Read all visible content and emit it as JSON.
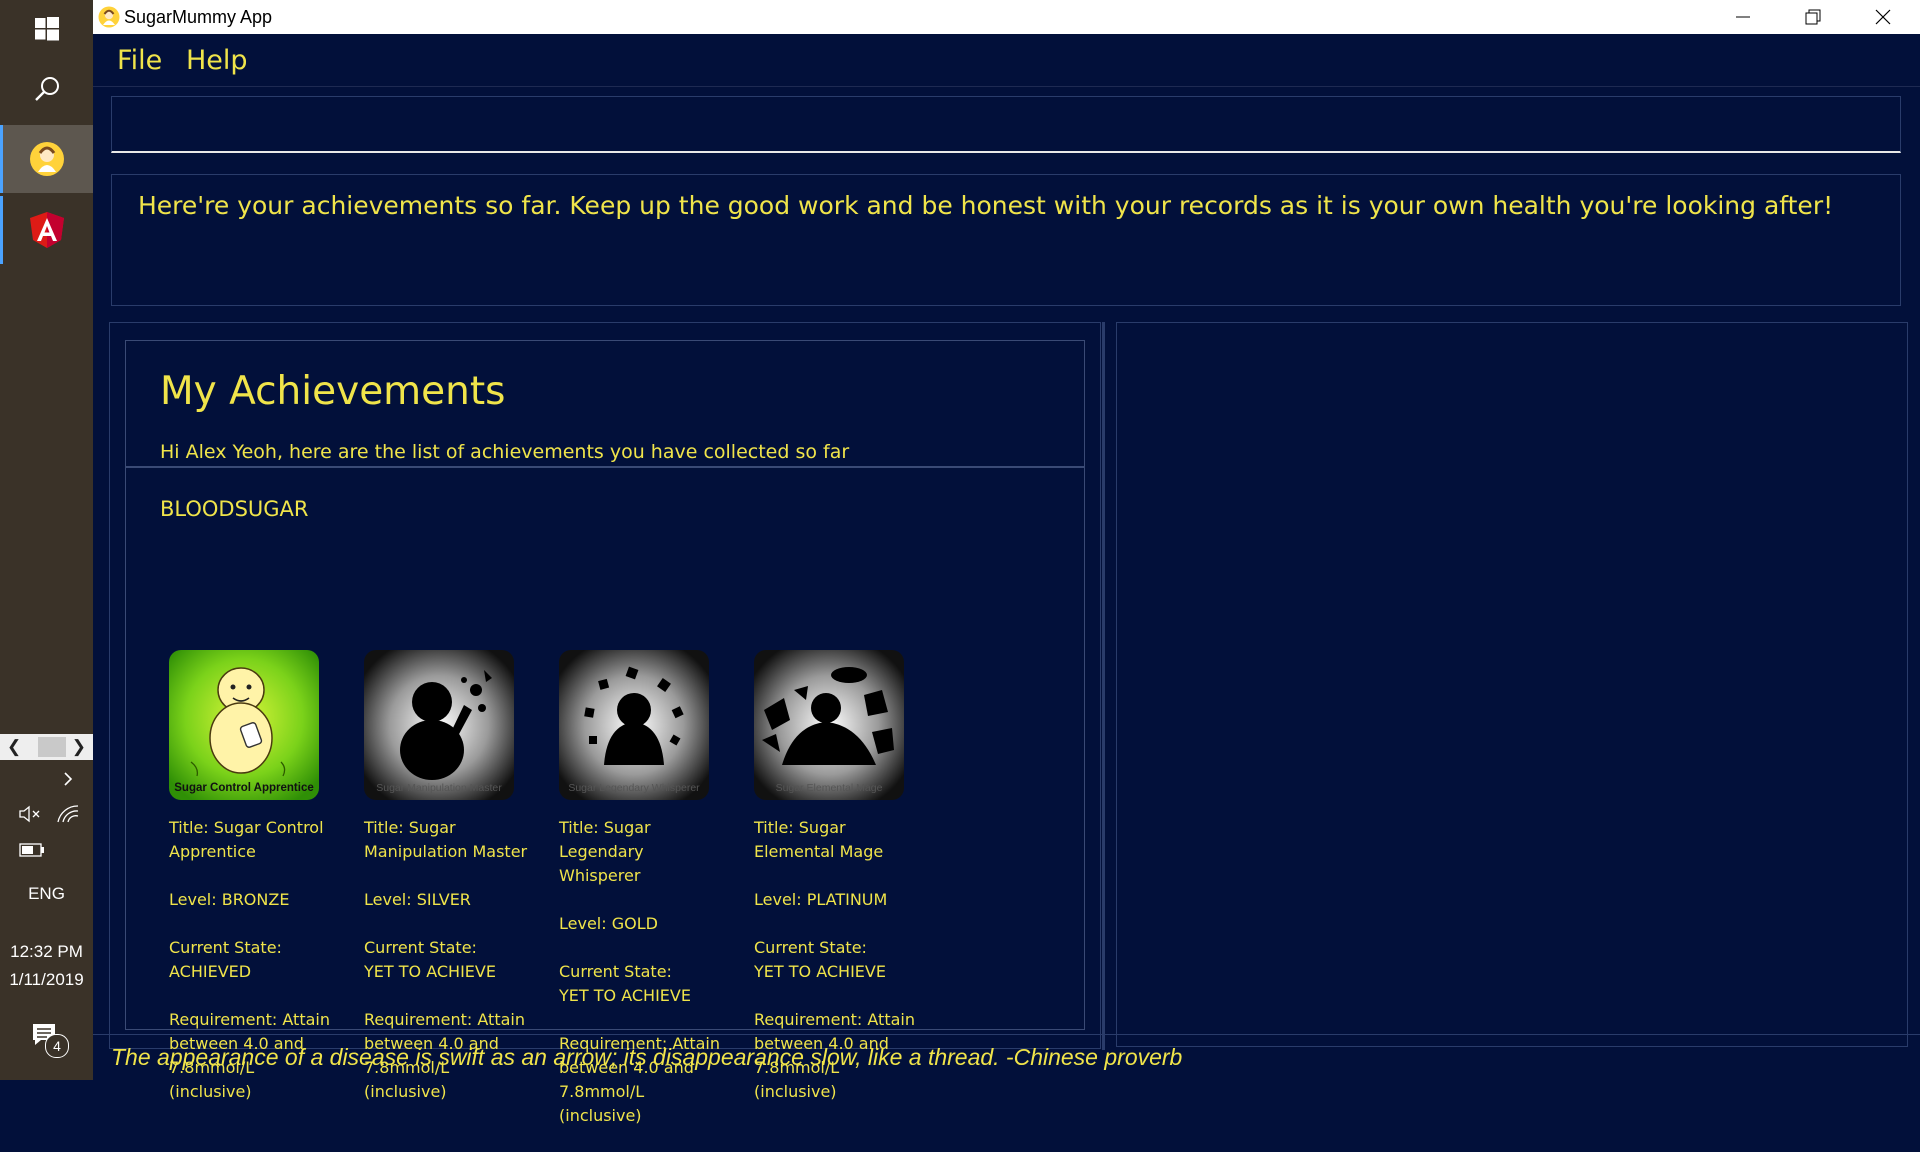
{
  "window": {
    "title": "SugarMummy App"
  },
  "menu": {
    "file": "File",
    "help": "Help"
  },
  "command_box": {
    "value": ""
  },
  "result_message": "Here're your achievements so far. Keep up the good work and be honest with your records as it is your own health you're looking after!",
  "achievements": {
    "heading": "My Achievements",
    "subtitle": "Hi Alex Yeoh, here are the list of achievements you have collected so far",
    "category": "BLOODSUGAR",
    "items": [
      {
        "badge_caption": "Sugar Control Apprentice",
        "title": "Title: Sugar Control Apprentice",
        "level": "Level: BRONZE",
        "state_label": "Current State:",
        "state": "ACHIEVED",
        "requirement": "Requirement: Attain between 4.0 and 7.8mmol/L (inclusive)"
      },
      {
        "badge_caption": "Sugar Manipulation Master",
        "title": "Title: Sugar Manipulation Master",
        "level": "Level: SILVER",
        "state_label": "Current State:",
        "state": "YET TO ACHIEVE",
        "requirement": "Requirement: Attain between 4.0 and 7.8mmol/L (inclusive)"
      },
      {
        "badge_caption": "Sugar Legendary Whisperer",
        "title": "Title: Sugar Legendary Whisperer",
        "level": "Level: GOLD",
        "state_label": "Current State:",
        "state": "YET TO ACHIEVE",
        "requirement": "Requirement: Attain between 4.0 and 7.8mmol/L (inclusive)"
      },
      {
        "badge_caption": "Sugar Elemental Mage",
        "title": "Title: Sugar Elemental Mage",
        "level": "Level: PLATINUM",
        "state_label": "Current State:",
        "state": "YET TO ACHIEVE",
        "requirement": "Requirement: Attain between 4.0 and 7.8mmol/L (inclusive)"
      }
    ]
  },
  "quote": "The appearance of a disease is swift as an arrow; its disappearance slow, like a thread. -Chinese proverb",
  "taskbar": {
    "language": "ENG",
    "time": "12:32 PM",
    "date": "1/11/2019",
    "notification_count": "4",
    "icons": [
      "windows-start-icon",
      "search-icon",
      "sugarmummy-app-icon",
      "angular-icon",
      "chevron-right-icon",
      "volume-muted-icon",
      "wifi-icon",
      "battery-icon",
      "action-center-icon"
    ]
  },
  "colors": {
    "background": "#02103a",
    "accent_text": "#f0e44a",
    "border": "#2a3c6a"
  }
}
